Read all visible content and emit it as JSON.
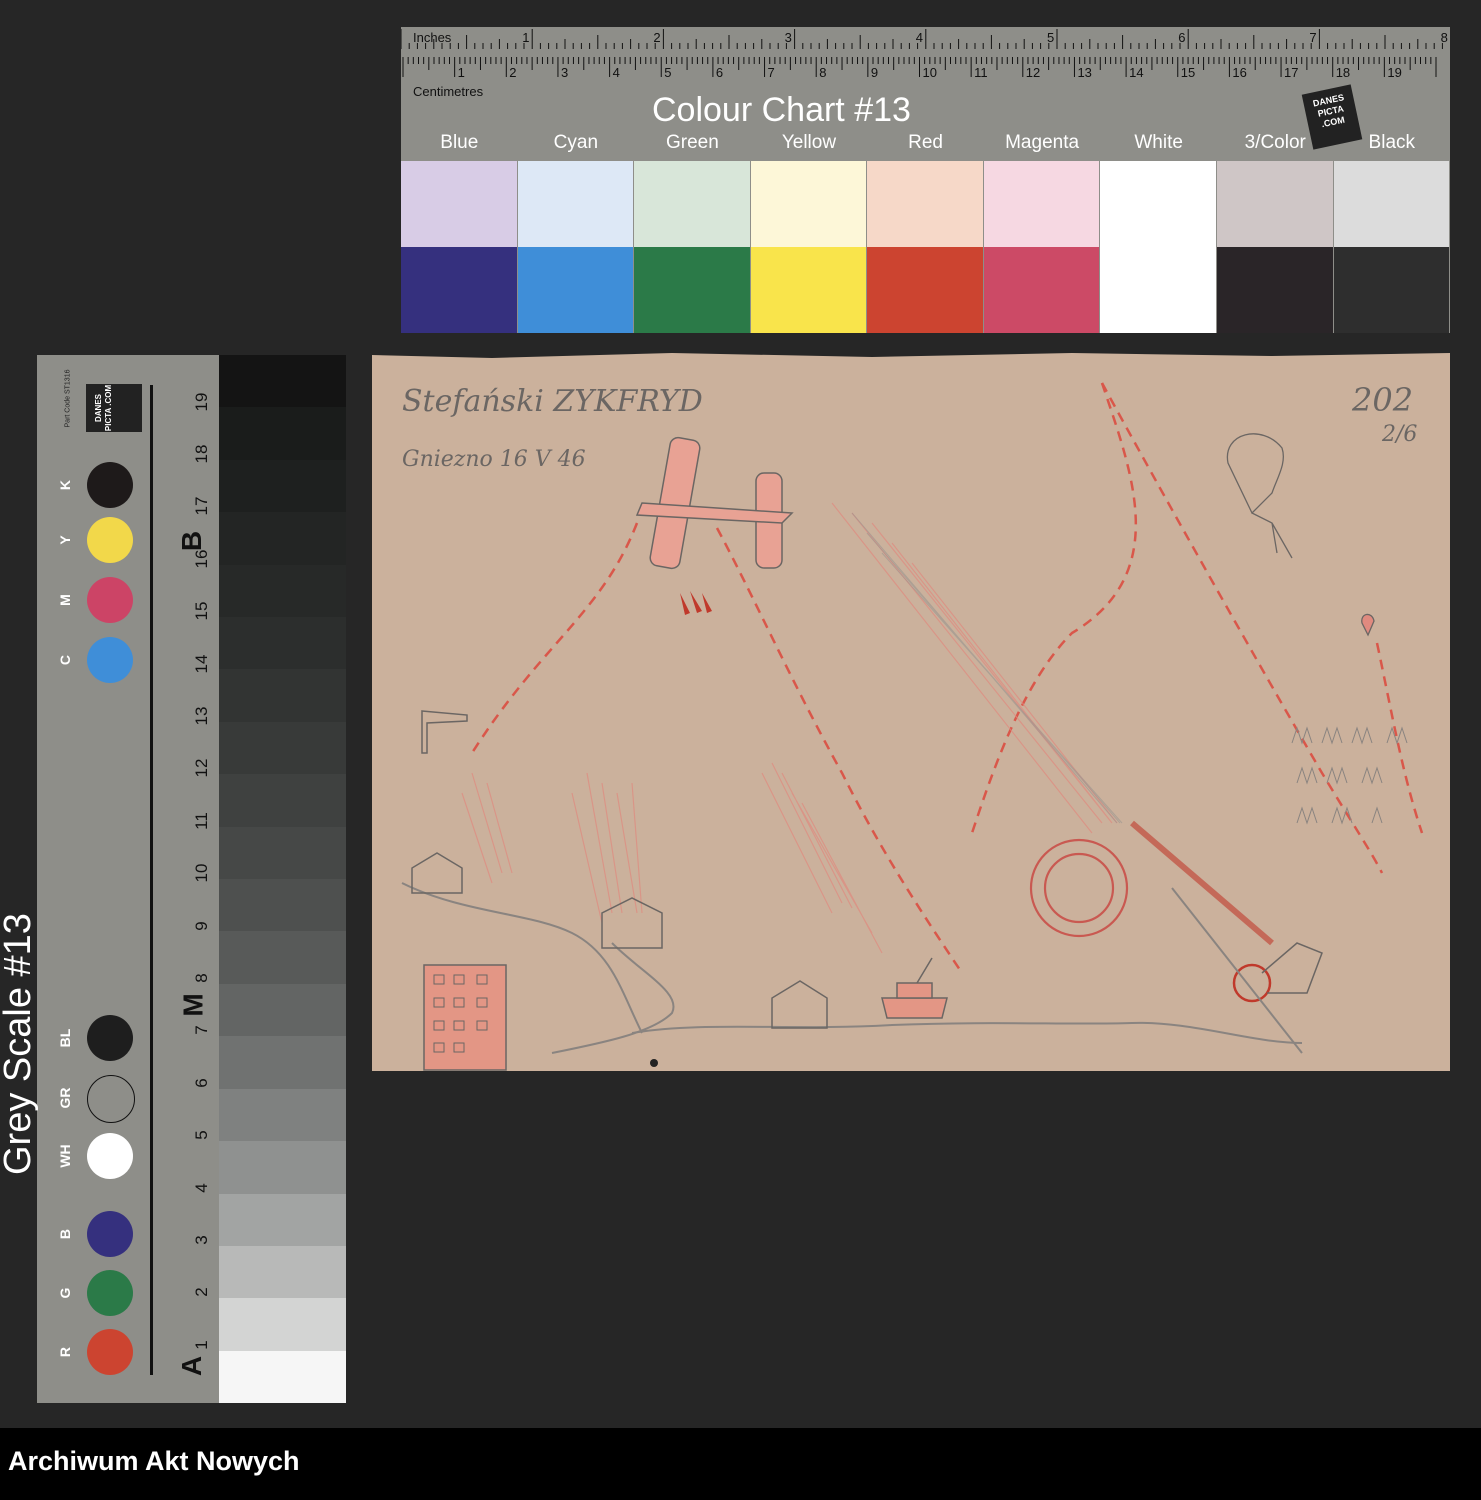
{
  "colour_chart": {
    "title": "Colour Chart #13",
    "ruler": {
      "inches_label": "Inches",
      "centimetres_label": "Centimetres",
      "inch_marks": [
        "1",
        "2",
        "3",
        "4",
        "5",
        "6",
        "7",
        "8"
      ],
      "cm_marks": [
        "1",
        "2",
        "3",
        "4",
        "5",
        "6",
        "7",
        "8",
        "9",
        "10",
        "11",
        "12",
        "13",
        "14",
        "15",
        "16",
        "17",
        "18",
        "19"
      ]
    },
    "logo_text": "DANES PICTA .COM",
    "names": [
      "Blue",
      "Cyan",
      "Green",
      "Yellow",
      "Red",
      "Magenta",
      "White",
      "3/Color",
      "Black"
    ],
    "light_colors": [
      "#d8cce6",
      "#dde8f6",
      "#d8e6d9",
      "#fdf7d8",
      "#f6d8c8",
      "#f6d8e2",
      "#ffffff",
      "#cfc6c6",
      "#dcdcdc"
    ],
    "dark_colors": [
      "#35307e",
      "#3f8ed8",
      "#2b7a48",
      "#f9e44b",
      "#cc4430",
      "#cc4a66",
      "#ffffff",
      "#2a2528",
      "#2e2e2e"
    ]
  },
  "grey_scale": {
    "title": "Grey Scale #13",
    "logo_text": "DANES PICTA .COM",
    "part_code": "Part Code ST1316",
    "numbers": [
      "19",
      "18",
      "17",
      "16",
      "15",
      "14",
      "13",
      "12",
      "11",
      "10",
      "9",
      "8",
      "7",
      "6",
      "5",
      "4",
      "3",
      "2",
      "1"
    ],
    "letters": [
      "B",
      "M",
      "A"
    ],
    "dots": [
      {
        "label": "K",
        "color": "#1e1a1a"
      },
      {
        "label": "Y",
        "color": "#f2d84a"
      },
      {
        "label": "M",
        "color": "#cc4466"
      },
      {
        "label": "C",
        "color": "#3f8ed8"
      },
      {
        "label": "BL",
        "color": "#1e1e1e"
      },
      {
        "label": "GR",
        "color": "#8e8e89"
      },
      {
        "label": "WH",
        "color": "#ffffff"
      },
      {
        "label": "B",
        "color": "#35307e"
      },
      {
        "label": "G",
        "color": "#2b7a48"
      },
      {
        "label": "R",
        "color": "#cc4430"
      }
    ],
    "steps": [
      "#141414",
      "#1a1c1b",
      "#1e201f",
      "#232524",
      "#272928",
      "#2c2e2d",
      "#323433",
      "#383a39",
      "#3f4140",
      "#464847",
      "#4e504f",
      "#585a59",
      "#636564",
      "#707271",
      "#7f8180",
      "#8f9190",
      "#a2a4a3",
      "#b8b9b8",
      "#d3d4d3",
      "#f6f6f6"
    ]
  },
  "drawing": {
    "author": "Stefański ZYKFRYD",
    "place_date": "Gniezno 16 V 46",
    "number_top": "202",
    "number_bottom": "2/6"
  },
  "footer": {
    "archive_name": "Archiwum Akt Nowych"
  }
}
